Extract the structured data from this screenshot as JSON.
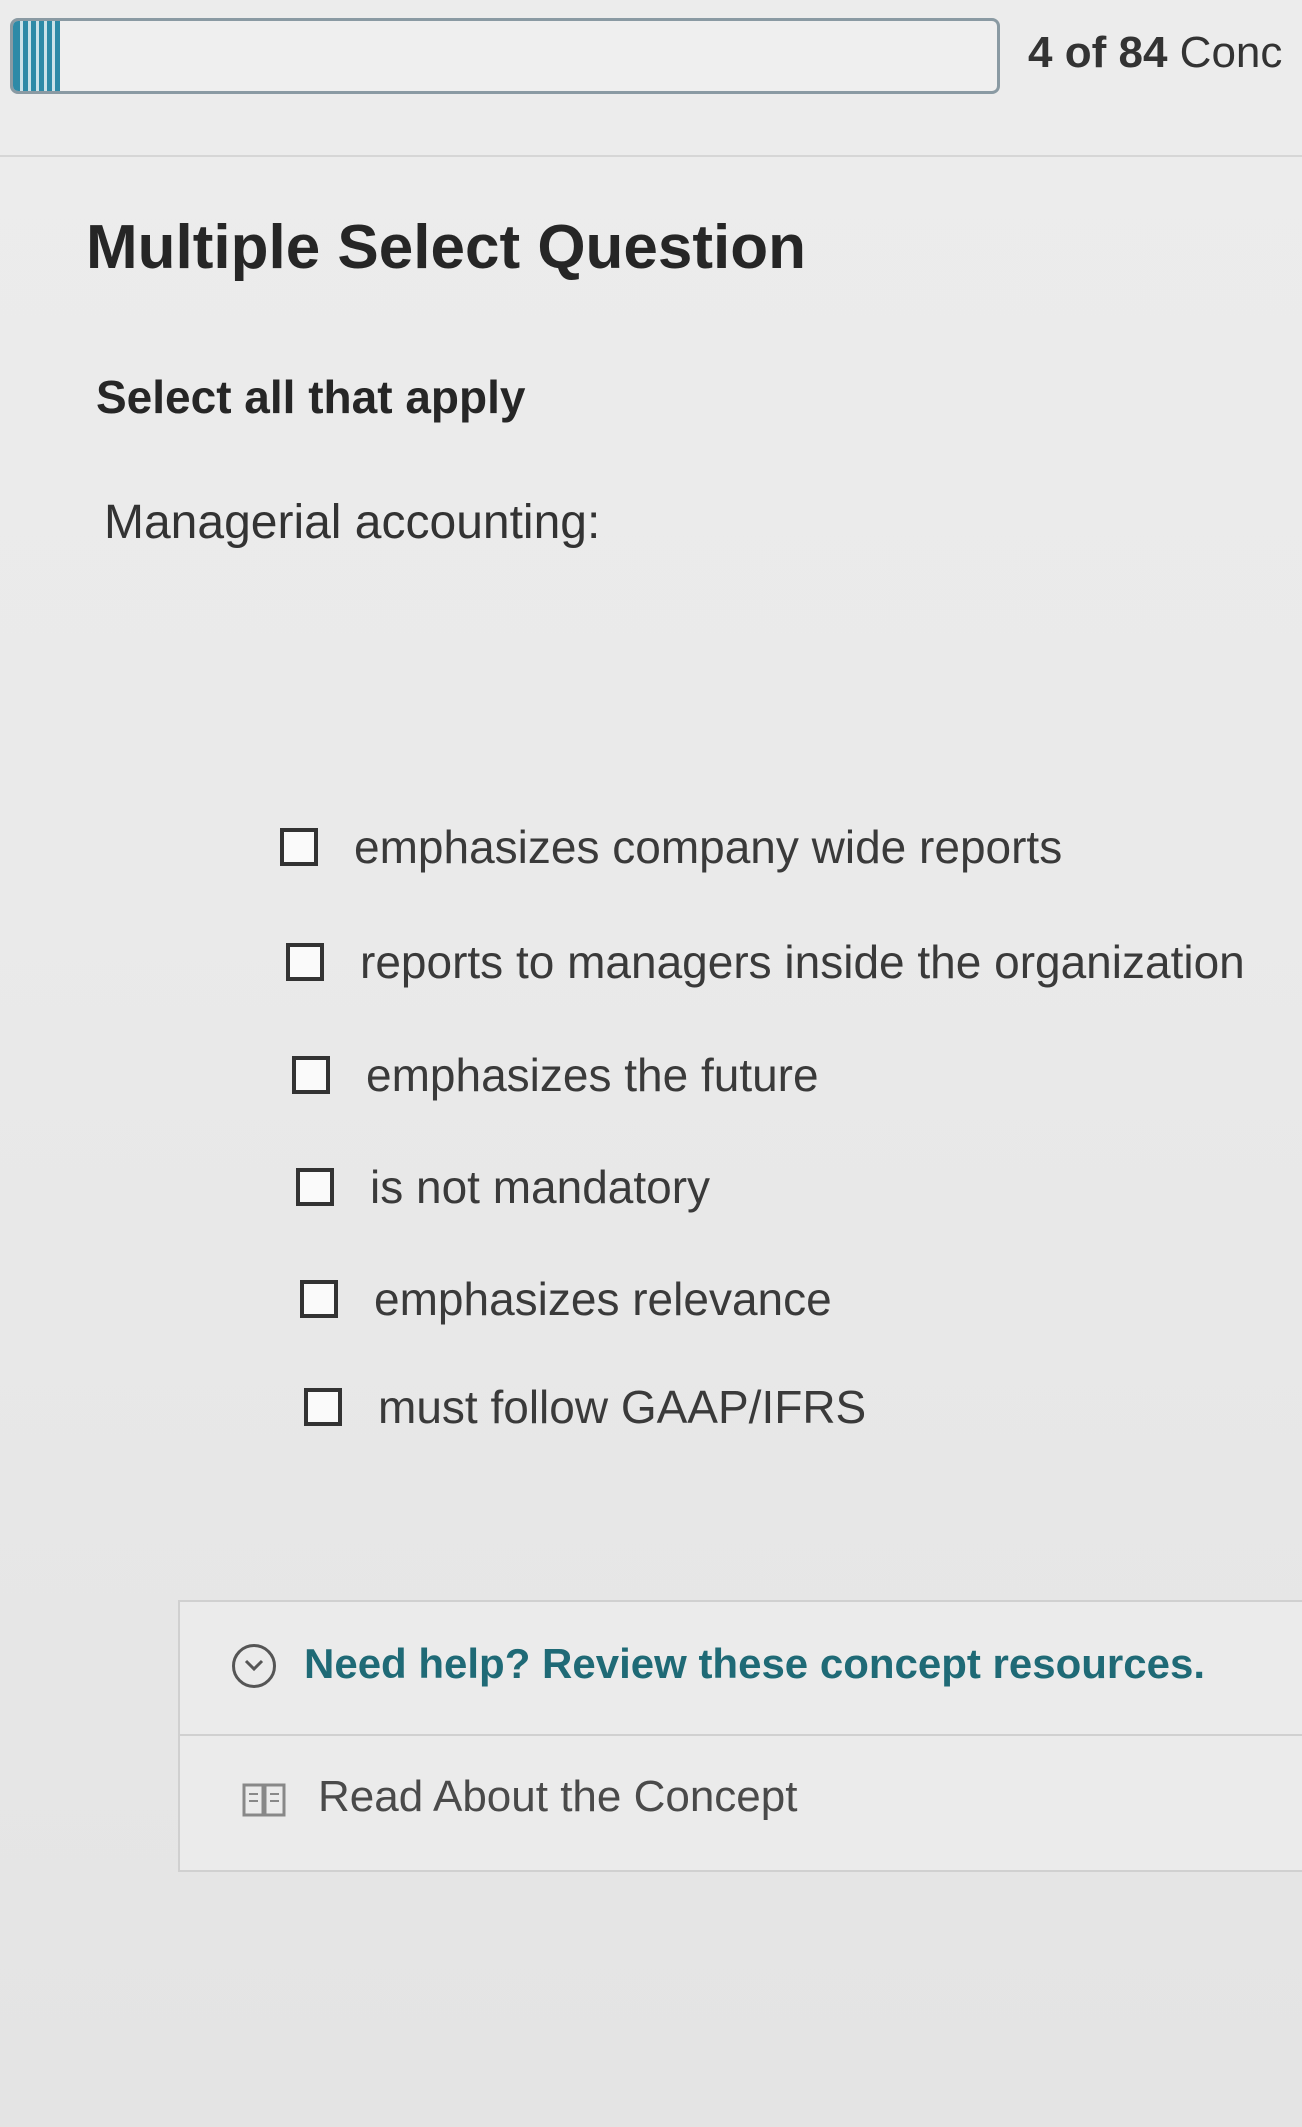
{
  "progress": {
    "current": "4",
    "of_label": "of",
    "total": "84",
    "suffix": "Conc",
    "fraction": 0.048
  },
  "question": {
    "type_label": "Multiple Select Question",
    "instruction": "Select all that apply",
    "prompt": "Managerial accounting:"
  },
  "options": [
    {
      "label": "emphasizes company wide reports",
      "checked": false
    },
    {
      "label": "reports to managers inside the organization",
      "checked": false
    },
    {
      "label": "emphasizes the future",
      "checked": false
    },
    {
      "label": "is not mandatory",
      "checked": false
    },
    {
      "label": "emphasizes relevance",
      "checked": false
    },
    {
      "label": "must follow GAAP/IFRS",
      "checked": false
    }
  ],
  "help": {
    "header": "Need help? Review these concept resources.",
    "resources": [
      {
        "label": "Read About the Concept",
        "icon": "book-icon"
      }
    ]
  },
  "colors": {
    "progress_fill": "#2e8aa7",
    "help_text": "#1f6a76"
  }
}
